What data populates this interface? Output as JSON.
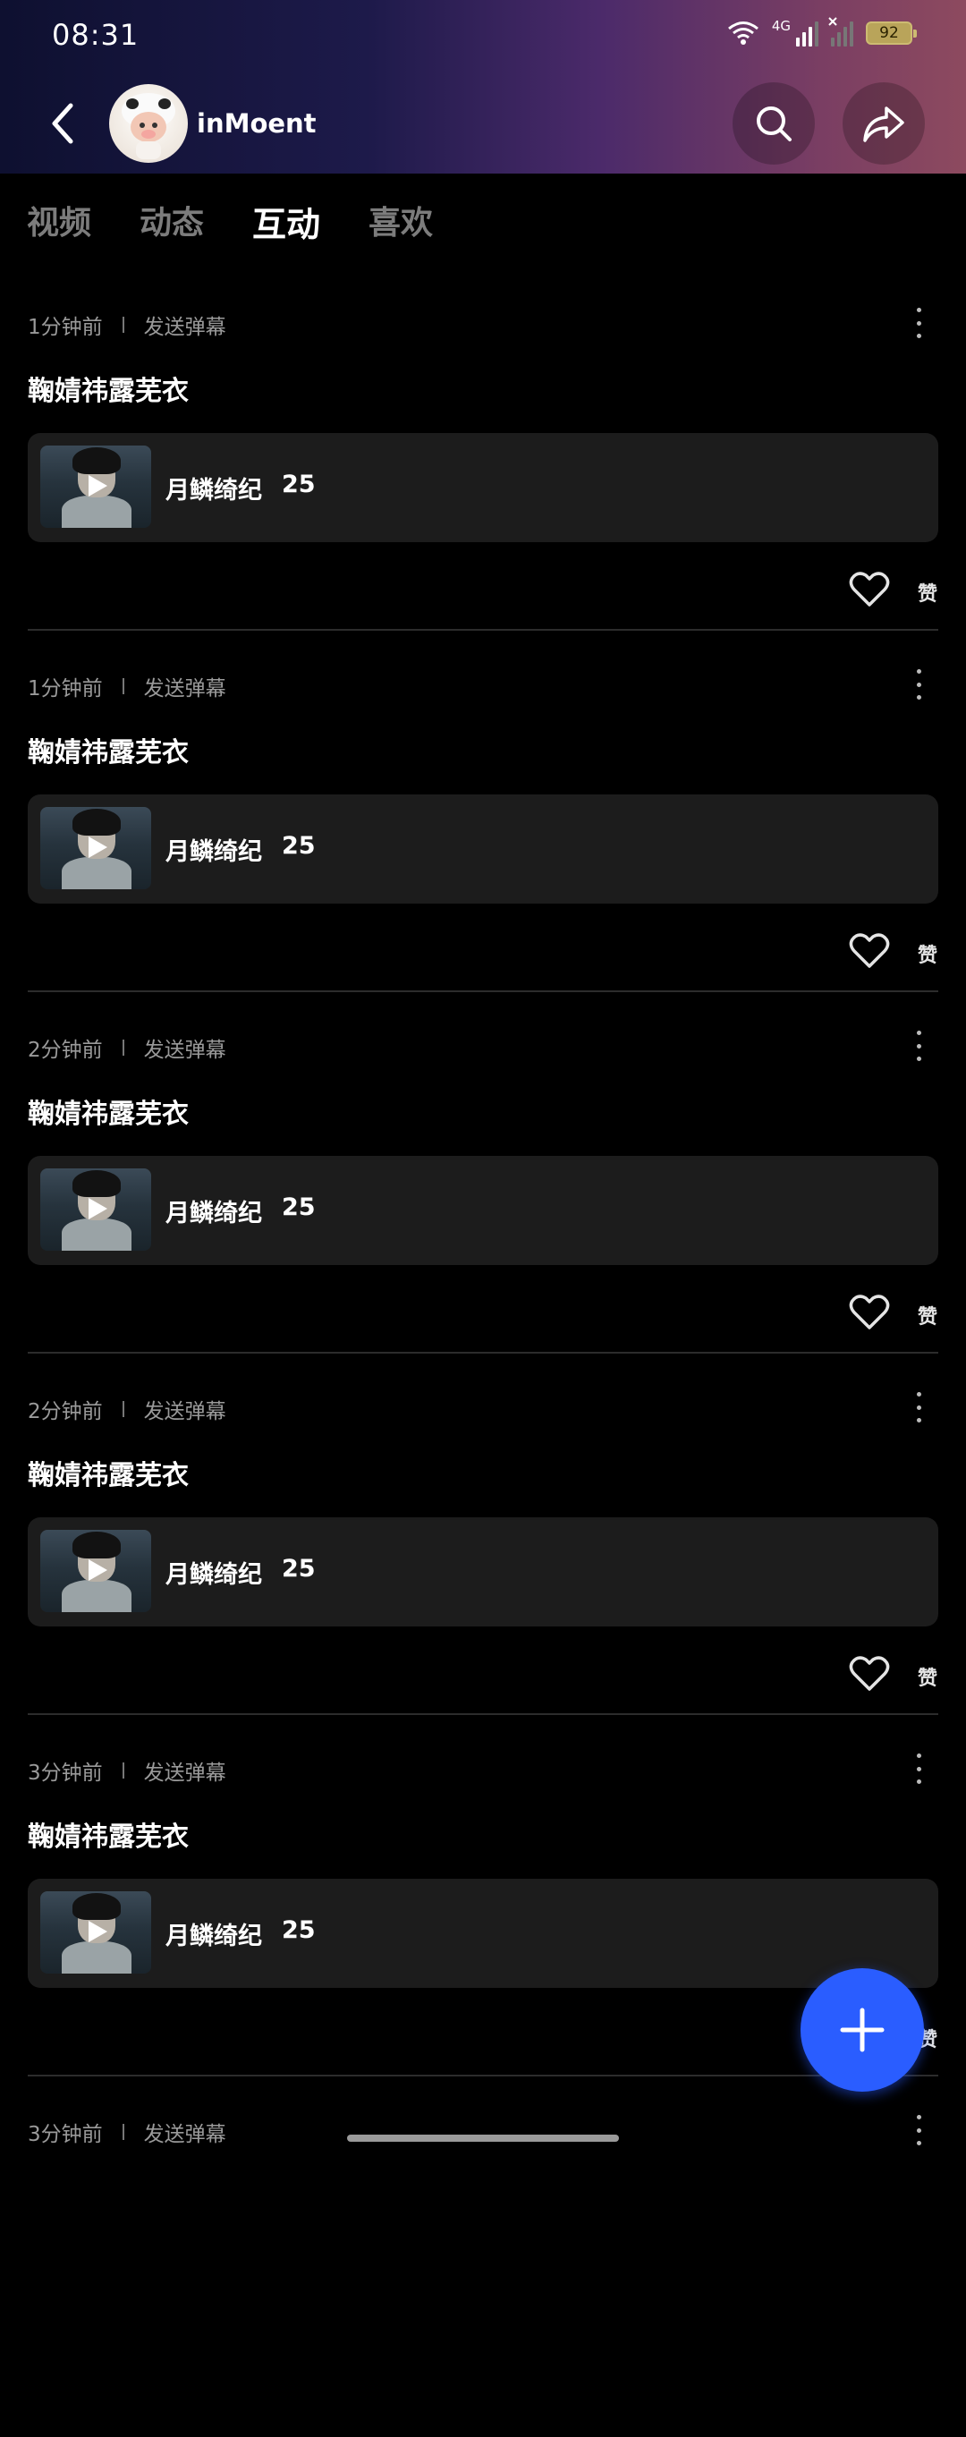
{
  "status_bar": {
    "time": "08:31",
    "network_label": "4G",
    "battery": "92",
    "icons": [
      "wifi-icon",
      "signal-icon",
      "signal-no-service-icon",
      "battery-icon"
    ]
  },
  "header": {
    "username": "inMoent",
    "icons": [
      "back-icon",
      "search-icon",
      "share-icon"
    ]
  },
  "tabs": [
    {
      "label": "视频",
      "active": false
    },
    {
      "label": "动态",
      "active": false
    },
    {
      "label": "互动",
      "active": true
    },
    {
      "label": "喜欢",
      "active": false
    }
  ],
  "feed": [
    {
      "time": "1分钟前",
      "action": "发送弹幕",
      "comment": "鞠婧祎露芜衣",
      "video_title": "月鳞绮纪",
      "episode": "25",
      "like_label": "赞"
    },
    {
      "time": "1分钟前",
      "action": "发送弹幕",
      "comment": "鞠婧祎露芜衣",
      "video_title": "月鳞绮纪",
      "episode": "25",
      "like_label": "赞"
    },
    {
      "time": "2分钟前",
      "action": "发送弹幕",
      "comment": "鞠婧祎露芜衣",
      "video_title": "月鳞绮纪",
      "episode": "25",
      "like_label": "赞"
    },
    {
      "time": "2分钟前",
      "action": "发送弹幕",
      "comment": "鞠婧祎露芜衣",
      "video_title": "月鳞绮纪",
      "episode": "25",
      "like_label": "赞"
    },
    {
      "time": "3分钟前",
      "action": "发送弹幕",
      "comment": "鞠婧祎露芜衣",
      "video_title": "月鳞绮纪",
      "episode": "25",
      "like_label": "赞"
    },
    {
      "time": "3分钟前",
      "action": "发送弹幕"
    }
  ],
  "colors": {
    "background": "#000000",
    "card": "#1c1c1c",
    "fab": "#2a5dff",
    "muted_text": "#9a9a9a"
  }
}
